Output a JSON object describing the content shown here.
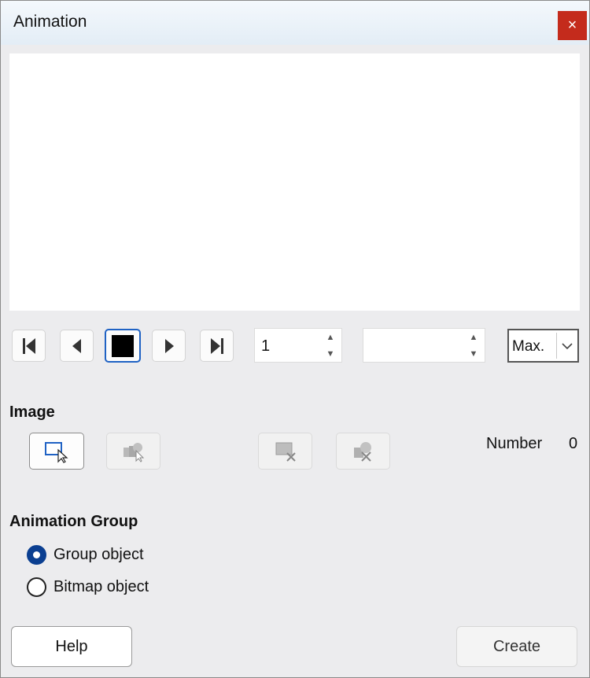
{
  "window": {
    "title": "Animation",
    "close_label": "×"
  },
  "playback": {
    "buttons": [
      "first-image",
      "backwards",
      "stop",
      "play",
      "last-image"
    ],
    "image_number": "1",
    "duration": "",
    "loop_value": "Max."
  },
  "image_section": {
    "heading": "Image",
    "buttons": [
      "apply-object",
      "apply-objects-individually",
      "delete-current-image",
      "delete-all-images"
    ],
    "number_label": "Number",
    "number_value": "0"
  },
  "animation_group": {
    "heading": "Animation Group",
    "options": [
      {
        "label": "Group object",
        "checked": true
      },
      {
        "label": "Bitmap object",
        "checked": false
      }
    ]
  },
  "footer": {
    "help_label": "Help",
    "create_label": "Create"
  },
  "colors": {
    "close": "#c42b1c",
    "accent": "#1f62c4",
    "radio_checked": "#0b3f91"
  }
}
